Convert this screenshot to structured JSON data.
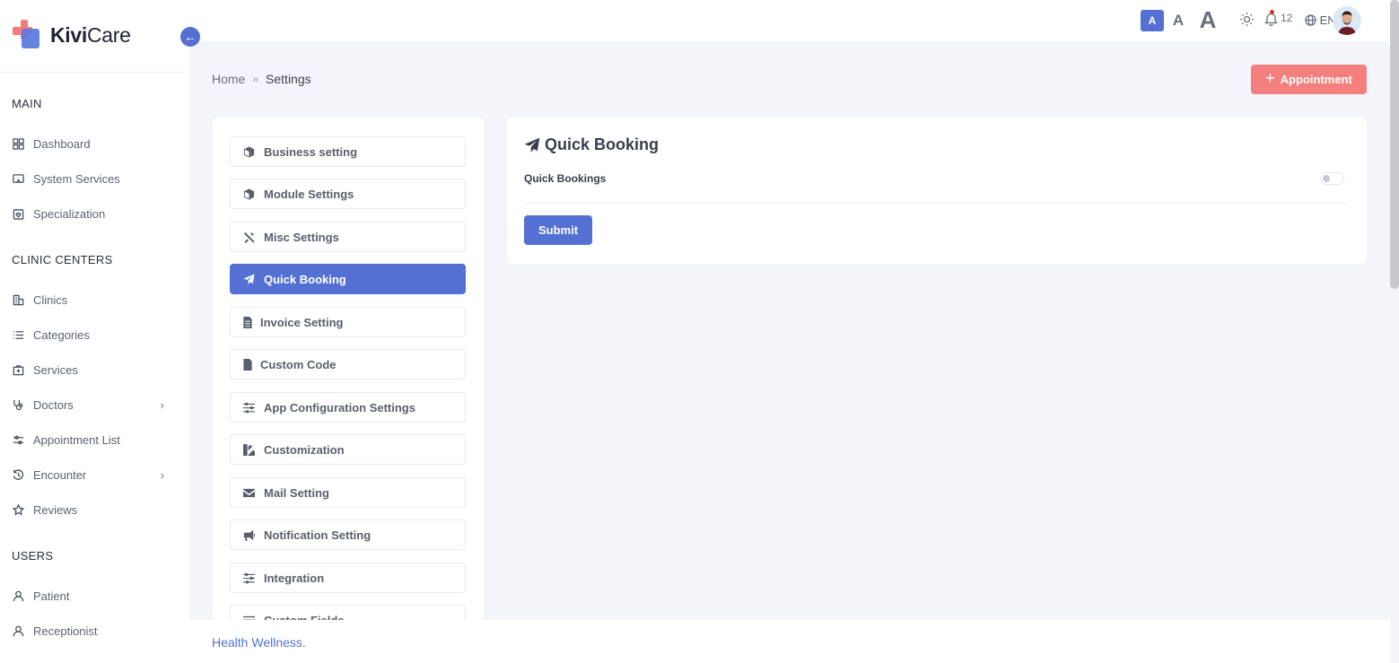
{
  "app": {
    "brand_bold": "Kivi",
    "brand_light": "Care"
  },
  "colors": {
    "primary": "#5470d3",
    "accent": "#f47f7f",
    "background": "#f4f5fa"
  },
  "sidebar": {
    "sections": [
      {
        "title": "MAIN",
        "items": [
          {
            "label": "Dashboard",
            "icon": "grid-icon"
          },
          {
            "label": "System Services",
            "icon": "monitor-icon"
          },
          {
            "label": "Specialization",
            "icon": "calendar-heart-icon"
          }
        ]
      },
      {
        "title": "CLINIC CENTERS",
        "items": [
          {
            "label": "Clinics",
            "icon": "building-icon"
          },
          {
            "label": "Categories",
            "icon": "list-icon"
          },
          {
            "label": "Services",
            "icon": "medical-kit-icon"
          },
          {
            "label": "Doctors",
            "icon": "stethoscope-icon",
            "has_submenu": true
          },
          {
            "label": "Appointment List",
            "icon": "sliders-icon"
          },
          {
            "label": "Encounter",
            "icon": "history-icon",
            "has_submenu": true
          },
          {
            "label": "Reviews",
            "icon": "star-icon"
          }
        ]
      },
      {
        "title": "USERS",
        "items": [
          {
            "label": "Patient",
            "icon": "user-icon"
          },
          {
            "label": "Receptionist",
            "icon": "user-icon"
          }
        ]
      }
    ]
  },
  "topbar": {
    "font_sizes": [
      "A",
      "A",
      "A"
    ],
    "notification_count": "12",
    "language": "EN"
  },
  "breadcrumb": {
    "home": "Home",
    "current": "Settings"
  },
  "actions": {
    "appointment_label": "Appointment"
  },
  "settings_menu": {
    "active_index": 3,
    "items": [
      {
        "label": "Business setting",
        "icon": "cube-icon"
      },
      {
        "label": "Module Settings",
        "icon": "cube-icon"
      },
      {
        "label": "Misc Settings",
        "icon": "tools-icon"
      },
      {
        "label": "Quick Booking",
        "icon": "paper-plane-icon"
      },
      {
        "label": "Invoice Setting",
        "icon": "invoice-icon"
      },
      {
        "label": "Custom Code",
        "icon": "code-file-icon"
      },
      {
        "label": "App Configuration Settings",
        "icon": "sliders-icon"
      },
      {
        "label": "Customization",
        "icon": "palette-icon"
      },
      {
        "label": "Mail Setting",
        "icon": "envelope-icon"
      },
      {
        "label": "Notification Setting",
        "icon": "megaphone-icon"
      },
      {
        "label": "Integration",
        "icon": "sliders-icon"
      },
      {
        "label": "Custom Fields",
        "icon": "list-icon"
      }
    ]
  },
  "content": {
    "title": "Quick Booking",
    "field_label": "Quick Bookings",
    "toggle_on": false,
    "submit_label": "Submit"
  },
  "footer": {
    "text": "Health Wellness."
  }
}
